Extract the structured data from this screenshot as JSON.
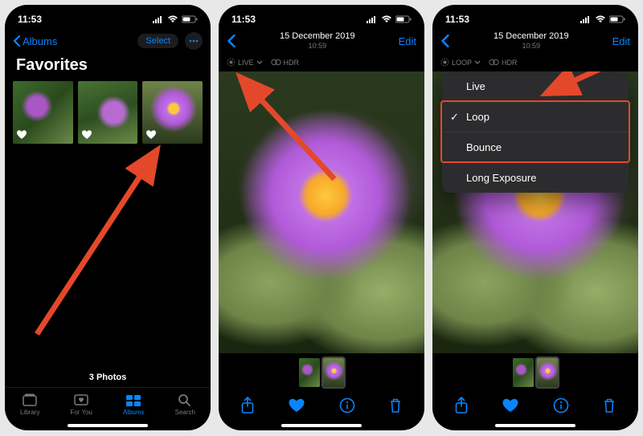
{
  "status": {
    "time": "11:53"
  },
  "screen1": {
    "back_label": "Albums",
    "select_label": "Select",
    "title": "Favorites",
    "count_label": "3 Photos",
    "tabs": {
      "library": "Library",
      "foryou": "For You",
      "albums": "Albums",
      "search": "Search"
    }
  },
  "screen2": {
    "date": "15 December 2019",
    "time": "10:59",
    "edit_label": "Edit",
    "badges": {
      "live": "LIVE",
      "hdr": "HDR"
    }
  },
  "screen3": {
    "date": "15 December 2019",
    "time": "10:59",
    "edit_label": "Edit",
    "badges": {
      "loop": "LOOP",
      "hdr": "HDR"
    },
    "menu": {
      "live": "Live",
      "loop": "Loop",
      "bounce": "Bounce",
      "long_exposure": "Long Exposure"
    }
  }
}
